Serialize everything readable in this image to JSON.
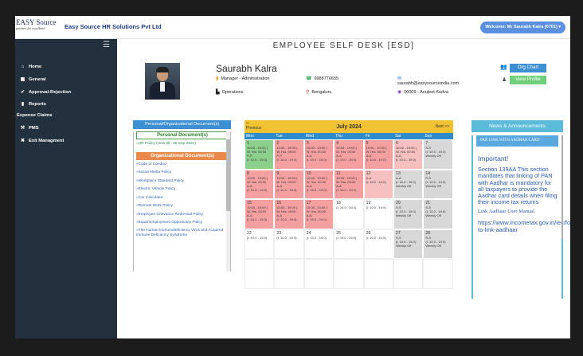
{
  "header": {
    "logo_line1": "EASY Source",
    "logo_line2": "partners for excellence",
    "company": "Easy Source HR Solutions Pvt Ltd",
    "welcome": "Welcome: Mr Saurabh Kalra [0701]"
  },
  "sidebar": {
    "items": [
      {
        "label": "Home",
        "icon": "home-icon"
      },
      {
        "label": "General",
        "icon": "calendar-icon"
      },
      {
        "label": "Approval-Rejection",
        "icon": "check-icon"
      },
      {
        "label": "Reports",
        "icon": "file-icon"
      },
      {
        "label": "Expense Claims",
        "icon": ""
      },
      {
        "label": "PMS",
        "icon": "gavel-icon"
      },
      {
        "label": "Exit Managment",
        "icon": "user-exit-icon"
      }
    ]
  },
  "page": {
    "title": "EMPLOYEE SELF DESK [ESD]"
  },
  "profile": {
    "name": "Saurabh Kalra",
    "designation": "Manager - Administration",
    "phone": "9988776655",
    "email": "saurabh@easysourceindia.com",
    "department": "Operations",
    "location": "Bengaluru",
    "manager": "00009 - Anujeet Kudva",
    "org_chart_label": "Org Chart",
    "view_profile_label": "View Profile"
  },
  "documents": {
    "header": "Personal/Organizational Document(s)",
    "personal_title": "Personal Document(s)",
    "personal_items": [
      "HR Policy (view till : 30 Sep 2024)"
    ],
    "org_title": "Organizational Document(s)",
    "org_items": [
      "Code of Conduct",
      "Social Media Policy",
      "Workplace Standard Policy",
      "Electric Vehicle Policy",
      "Car Calculator",
      "Remote Work Policy",
      "Employee Grievance Redressal Policy",
      "Equal Employment Opportunity Policy",
      "The Human Immunodeficiency Virus and Acquired Immune Deficiency Syndrome"
    ]
  },
  "calendar": {
    "prev": "Previous",
    "next": "Next >>",
    "month": "July 2024",
    "days": [
      "Mon",
      "Tue",
      "Wed",
      "Thu",
      "Fri",
      "Sat",
      "Sun"
    ],
    "cells": [
      {
        "day": "1",
        "l1": "10:00 - 19:00 (",
        "l2": "W. Hrs. 00:00",
        "l3": "P-P",
        "l4": "(I: 10.0 - 19.0)",
        "tone": "green"
      },
      {
        "day": "2",
        "l1": "10:00 - 19:00 (",
        "l2": "W. Hrs. 09:00",
        "l3": "P-P",
        "l4": "(I: 10.0 - 19.0)",
        "tone": "red"
      },
      {
        "day": "3",
        "l1": "10:00 - 19:00 (",
        "l2": "W. Hrs. 00:00",
        "l3": "A-A",
        "l4": "(I: 10.0 - 19.0)",
        "tone": "red"
      },
      {
        "day": "4",
        "l1": "10:00 - 19:00 (",
        "l2": "W. Hrs. 00:00",
        "l3": "A-A",
        "l4": "(I: 10.0 - 19.0)",
        "tone": "red"
      },
      {
        "day": "5",
        "l1": "10:00 - 19:00 (",
        "l2": "W. Hrs. 00:00",
        "l3": "A-A",
        "l4": "(I: 10.0 - 19.0)",
        "tone": "red"
      },
      {
        "day": "6",
        "l1": "10:00 - 19:00 (",
        "l2": "W. Hrs. 00:00",
        "l3": "A-A",
        "l4": "(I: 10.0 - 19.0)",
        "tone": "redp"
      },
      {
        "day": "7",
        "l1": "S-S",
        "l2": "(I: 10.0 - 19.0)",
        "l3": "Weekly Off",
        "l4": "",
        "tone": "gray"
      },
      {
        "day": "8",
        "l1": "10:00 - 19:00 (",
        "l2": "W. Hrs. 00:00",
        "l3": "A-A",
        "l4": "(I: 10.0 - 19.0)",
        "tone": "red"
      },
      {
        "day": "9",
        "l1": "10:00 - 19:00 (",
        "l2": "W. Hrs. 00:00",
        "l3": "A-A",
        "l4": "(I: 10.0 - 19.0)",
        "tone": "red"
      },
      {
        "day": "10",
        "l1": "10:00 - 19:00 (",
        "l2": "W. Hrs. 00:00",
        "l3": "A-A",
        "l4": "(I: 10.0 - 19.0)",
        "tone": "red"
      },
      {
        "day": "11",
        "l1": "10:00 - 19:00 (",
        "l2": "W. Hrs. 00:00",
        "l3": "A-A",
        "l4": "(I: 10.0 - 19.0)",
        "tone": "red"
      },
      {
        "day": "12",
        "l1": "A-A",
        "l2": "(I: 10.0 - 19.0)",
        "l3": "",
        "l4": "",
        "tone": "redp"
      },
      {
        "day": "13",
        "l1": "A-A",
        "l2": "(I: 10.0 - 19.0)",
        "l3": "Weekly Off",
        "l4": "",
        "tone": "gray"
      },
      {
        "day": "14",
        "l1": "S-S",
        "l2": "(I: 10.0 - 19.0)",
        "l3": "Weekly Off",
        "l4": "",
        "tone": "gray"
      },
      {
        "day": "15",
        "l1": "10:00 - 19:00 (",
        "l2": "W. Hrs. 00:00",
        "l3": "A-A",
        "l4": "(I: 10.0 - 19.0)",
        "tone": "red"
      },
      {
        "day": "16",
        "l1": "10:00 - 19:00 (",
        "l2": "W. Hrs. 00:00",
        "l3": "A-A",
        "l4": "(I: 10.0 - 19.0)",
        "tone": "red"
      },
      {
        "day": "17",
        "l1": "10:00 - 19:00 (",
        "l2": "W. Hrs. 00:00",
        "l3": "A-A",
        "l4": "(I: 10.0 - 19.0)",
        "tone": "red"
      },
      {
        "day": "18",
        "l1": "(I: 10.0 - 19.0)",
        "l2": "",
        "l3": "",
        "l4": "",
        "tone": "white"
      },
      {
        "day": "19",
        "l1": "(I: 10.0 - 19.0)",
        "l2": "",
        "l3": "",
        "l4": "",
        "tone": "white"
      },
      {
        "day": "20",
        "l1": "S-S",
        "l2": "(I: 10.0 - 19.0)",
        "l3": "Weekly Off",
        "l4": "",
        "tone": "gray"
      },
      {
        "day": "21",
        "l1": "S-S",
        "l2": "(I: 10.0 - 19.0)",
        "l3": "Weekly Off",
        "l4": "",
        "tone": "gray"
      },
      {
        "day": "22",
        "l1": "(I: 10.0 - 19.0)",
        "l2": "",
        "l3": "",
        "l4": "",
        "tone": "white"
      },
      {
        "day": "23",
        "l1": "(I: 10.0 - 19.0)",
        "l2": "",
        "l3": "",
        "l4": "",
        "tone": "white"
      },
      {
        "day": "24",
        "l1": "(I: 10.0 - 19.0)",
        "l2": "",
        "l3": "",
        "l4": "",
        "tone": "white"
      },
      {
        "day": "25",
        "l1": "(I: 10.0 - 19.0)",
        "l2": "",
        "l3": "",
        "l4": "",
        "tone": "white"
      },
      {
        "day": "26",
        "l1": "(I: 10.0 - 19.0)",
        "l2": "",
        "l3": "",
        "l4": "",
        "tone": "white"
      },
      {
        "day": "27",
        "l1": "S-S",
        "l2": "(I: 10.0 - 19.0)",
        "l3": "Weekly Off",
        "l4": "",
        "tone": "gray"
      },
      {
        "day": "28",
        "l1": "S-S",
        "l2": "(I: 10.0 - 19.0)",
        "l3": "Weekly Off",
        "l4": "",
        "tone": "gray"
      },
      {
        "day": "",
        "l1": "",
        "l2": "",
        "l3": "",
        "l4": "",
        "tone": "white"
      },
      {
        "day": "",
        "l1": "",
        "l2": "",
        "l3": "",
        "l4": "",
        "tone": "white"
      },
      {
        "day": "",
        "l1": "",
        "l2": "",
        "l3": "",
        "l4": "",
        "tone": "white"
      },
      {
        "day": "",
        "l1": "",
        "l2": "",
        "l3": "",
        "l4": "",
        "tone": "white"
      },
      {
        "day": "",
        "l1": "",
        "l2": "",
        "l3": "",
        "l4": "",
        "tone": "white"
      },
      {
        "day": "",
        "l1": "",
        "l2": "",
        "l3": "",
        "l4": "",
        "tone": "white"
      },
      {
        "day": "",
        "l1": "",
        "l2": "",
        "l3": "",
        "l4": "",
        "tone": "white"
      }
    ]
  },
  "news": {
    "header": "News & Announcements",
    "title": "PAN LINK WITH AADHAR CARD",
    "important": "Important!",
    "text": "Section 139AA This section mandates that linking of PAN with Aadhar is mandatory for all taxpayers to provide the Aadhar card details when filing their income tax returns",
    "link_label": "Link Aadhaar User Manual",
    "url": "https://www.incometax.gov.in/iec/foportal/help/how-to-link-aadhaar"
  },
  "colors": {
    "sidebar": "#23303e",
    "accent": "#3c8fd0",
    "present": "#8dcf8d",
    "absent": "#f5a0a0",
    "weekly_off": "#d8d8d8"
  }
}
